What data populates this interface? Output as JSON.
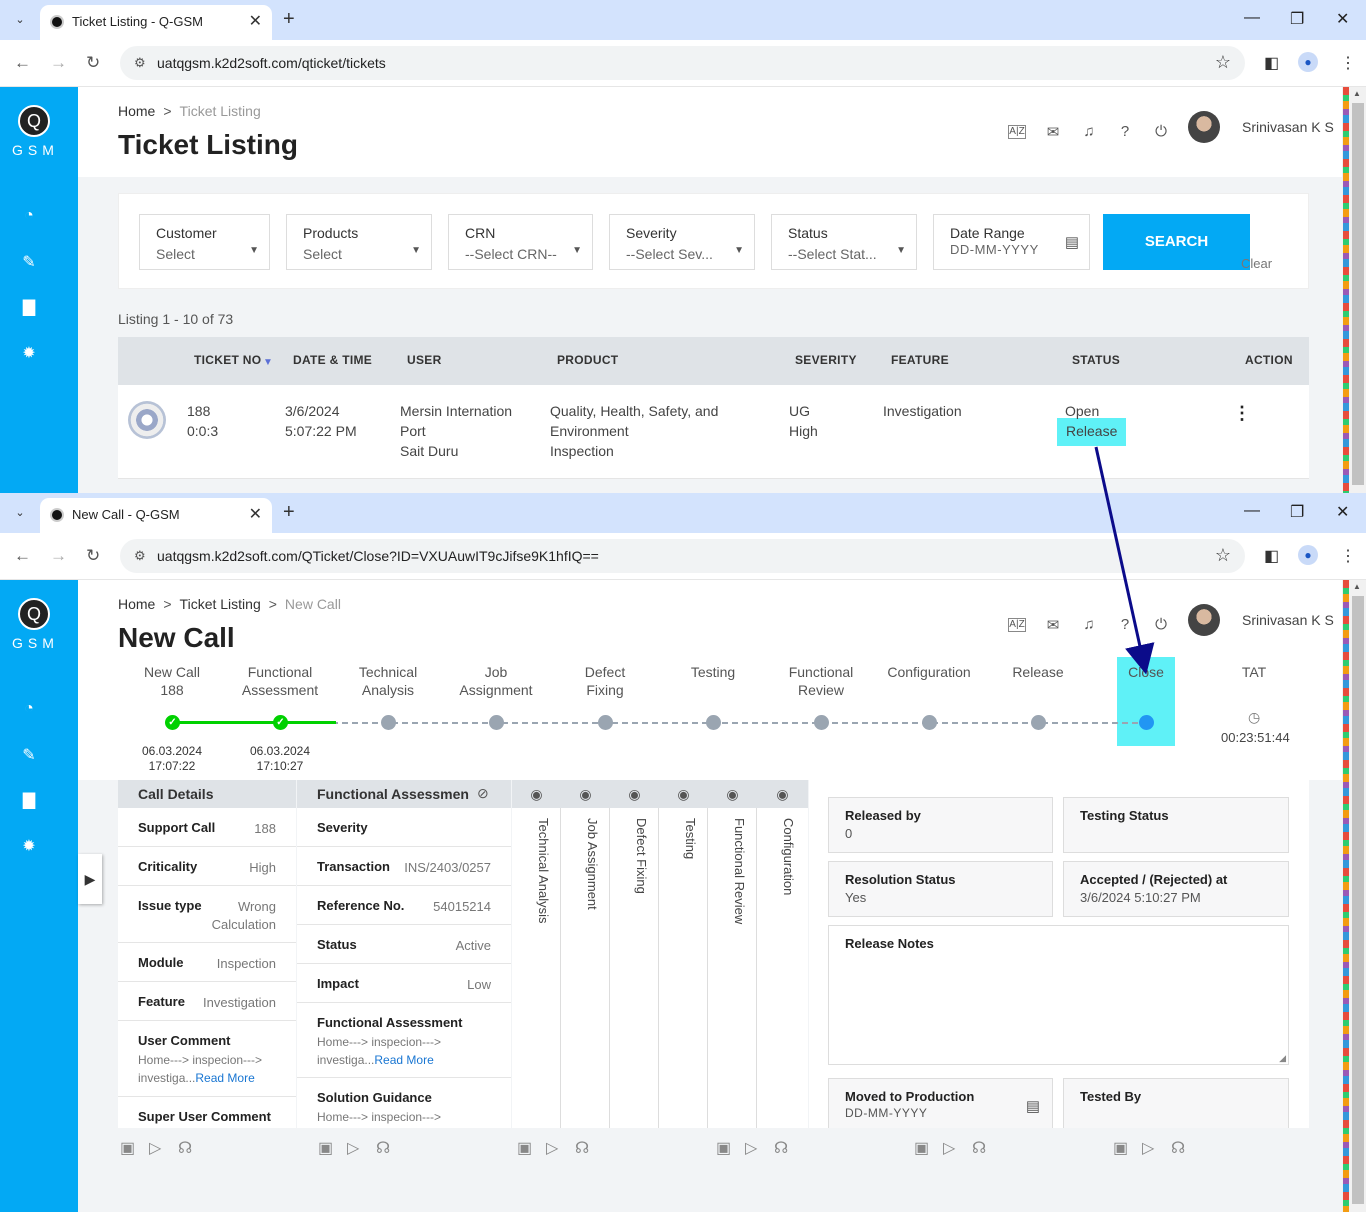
{
  "window1": {
    "tab_title": "Ticket Listing - Q-GSM",
    "url": "uatqgsm.k2d2soft.com/qticket/tickets",
    "breadcrumb": {
      "home": "Home",
      "current": "Ticket Listing"
    },
    "page_title": "Ticket Listing",
    "user_name": "Srinivasan K S",
    "filters": [
      {
        "label": "Customer",
        "value": "Select"
      },
      {
        "label": "Products",
        "value": "Select"
      },
      {
        "label": "CRN",
        "value": "--Select CRN--"
      },
      {
        "label": "Severity",
        "value": "--Select Sev..."
      },
      {
        "label": "Status",
        "value": "--Select Stat..."
      }
    ],
    "date_range": {
      "label": "Date Range",
      "placeholder": "DD-MM-YYYY"
    },
    "search_label": "SEARCH",
    "clear_label": "Clear",
    "listing_text": "Listing 1 - 10 of 73",
    "columns": [
      "TICKET NO",
      "DATE & TIME",
      "USER",
      "PRODUCT",
      "SEVERITY",
      "FEATURE",
      "STATUS",
      "ACTION"
    ],
    "row": {
      "ticket": "188\n0:0:3",
      "datetime": "3/6/2024\n5:07:22 PM",
      "user": "Mersin Internation\nPort\nSait Duru",
      "product": "Quality, Health, Safety, and\nEnvironment\nInspection",
      "severity": "UG\nHigh",
      "feature": "Investigation",
      "status": "Open",
      "status2": "Release"
    }
  },
  "window2": {
    "tab_title": "New Call - Q-GSM",
    "url": "uatqgsm.k2d2soft.com/QTicket/Close?ID=VXUAuwIT9cJifse9K1hfIQ==",
    "breadcrumb": {
      "home": "Home",
      "mid": "Ticket Listing",
      "current": "New Call"
    },
    "page_title": "New Call",
    "user_name": "Srinivasan K S",
    "steps": [
      {
        "label": "New Call\n188",
        "date": "06.03.2024\n17:07:22",
        "state": "done"
      },
      {
        "label": "Functional\nAssessment",
        "date": "06.03.2024\n17:10:27",
        "state": "done"
      },
      {
        "label": "Technical\nAnalysis",
        "date": "",
        "state": "pending"
      },
      {
        "label": "Job\nAssignment",
        "date": "",
        "state": "pending"
      },
      {
        "label": "Defect\nFixing",
        "date": "",
        "state": "pending"
      },
      {
        "label": "Testing",
        "date": "",
        "state": "pending"
      },
      {
        "label": "Functional\nReview",
        "date": "",
        "state": "pending"
      },
      {
        "label": "Configuration",
        "date": "",
        "state": "pending"
      },
      {
        "label": "Release",
        "date": "",
        "state": "pending"
      },
      {
        "label": "Close",
        "date": "",
        "state": "current"
      }
    ],
    "tat": {
      "label": "TAT",
      "value": "00:23:51:44"
    },
    "call_details": {
      "title": "Call Details",
      "support_call_k": "Support Call",
      "support_call_v": "188",
      "criticality_k": "Criticality",
      "criticality_v": "High",
      "issue_type_k": "Issue type",
      "issue_type_v": "Wrong\nCalculation",
      "module_k": "Module",
      "module_v": "Inspection",
      "feature_k": "Feature",
      "feature_v": "Investigation",
      "user_comment_k": "User Comment",
      "user_comment_v": "Home---> inspecion--->\ninvestiga...",
      "super_user_comment_k": "Super User Comment",
      "read_more": "Read More"
    },
    "functional": {
      "title": "Functional Assessmen",
      "severity_k": "Severity",
      "transaction_k": "Transaction",
      "transaction_v": "INS/2403/0257",
      "reference_k": "Reference No.",
      "reference_v": "54015214",
      "status_k": "Status",
      "status_v": "Active",
      "impact_k": "Impact",
      "impact_v": "Low",
      "fa_k": "Functional Assessment",
      "fa_v": "Home---> inspecion--->\ninvestiga...",
      "sg_k": "Solution Guidance",
      "sg_v": "Home---> inspecion--->",
      "read_more": "Read More"
    },
    "vertical_columns": [
      "Technical Analysis",
      "Job Assignment",
      "Defect Fixing",
      "Testing",
      "Functional Review",
      "Configuration"
    ],
    "release": {
      "released_by_k": "Released by",
      "released_by_v": "0",
      "testing_status_k": "Testing Status",
      "resolution_status_k": "Resolution Status",
      "resolution_status_v": "Yes",
      "accepted_k": "Accepted / (Rejected) at",
      "accepted_v": "3/6/2024 5:10:27 PM",
      "release_notes_k": "Release Notes",
      "moved_k": "Moved to Production",
      "moved_placeholder": "DD-MM-YYYY",
      "tested_by_k": "Tested By"
    }
  },
  "highlight_color": "#5ff1f7",
  "accent": "#03a9f4",
  "done_color": "#00d100",
  "arrow_color": "#0b0b8a"
}
